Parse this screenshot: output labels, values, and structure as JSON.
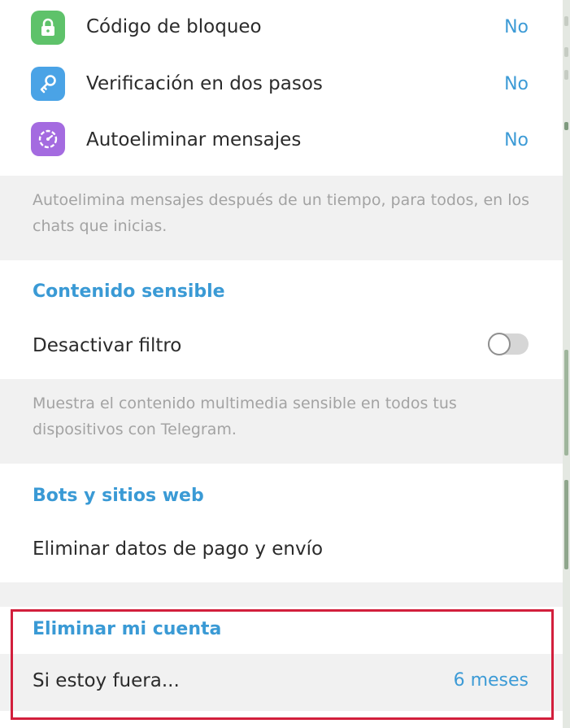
{
  "privacy": {
    "items": [
      {
        "label": "Código de bloqueo",
        "value": "No",
        "icon": "lock-icon",
        "color": "#5ec26a"
      },
      {
        "label": "Verificación en dos pasos",
        "value": "No",
        "icon": "key-icon",
        "color": "#4aa3e6"
      },
      {
        "label": "Autoeliminar mensajes",
        "value": "No",
        "icon": "timer-icon",
        "color": "#a46be0"
      }
    ],
    "autodelete_hint": "Autoelimina mensajes después de un tiempo, para todos, en los chats que inicias."
  },
  "sensitive": {
    "title": "Contenido sensible",
    "toggle_label": "Desactivar filtro",
    "toggle_on": false,
    "hint": "Muestra el contenido multimedia sensible en todos tus dispositivos con Telegram."
  },
  "bots": {
    "title": "Bots y sitios web",
    "clear_payment_label": "Eliminar datos de pago y envío"
  },
  "delete_account": {
    "title": "Eliminar mi cuenta",
    "if_away_label": "Si estoy fuera...",
    "if_away_value": "6 meses"
  },
  "colors": {
    "accent": "#3a9ad5",
    "highlight": "#d21f3c"
  }
}
